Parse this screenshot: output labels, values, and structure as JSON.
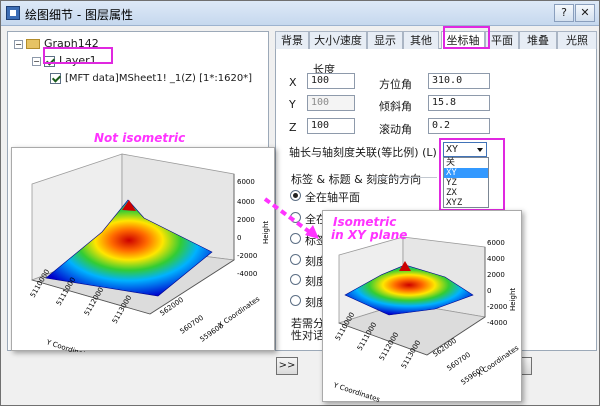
{
  "window": {
    "title": "绘图细节 - 图层属性",
    "help_label": "?",
    "close_label": "✕"
  },
  "tree": {
    "graph": "Graph142",
    "layer": "Layer1",
    "data": "[MFT data]MSheet1! _1(Z) [1*:1620*]"
  },
  "tabs": [
    "背景",
    "大小/速度",
    "显示",
    "其他",
    "坐标轴",
    "平面",
    "堆叠",
    "光照"
  ],
  "axis_form": {
    "length_header": "长度",
    "rows": [
      {
        "axis": "X",
        "length": "100",
        "angle_label": "方位角",
        "angle_value": "310.0"
      },
      {
        "axis": "Y",
        "length": "100",
        "angle_label": "倾斜角",
        "angle_value": "15.8"
      },
      {
        "axis": "Z",
        "length": "100",
        "angle_label": "滚动角",
        "angle_value": "0.2"
      }
    ],
    "link_label": "轴长与轴刻度关联(等比例) (L)",
    "dropdown": {
      "selected": "XY",
      "options": [
        "关",
        "XY",
        "YZ",
        "ZX",
        "XYZ"
      ],
      "highlighted_option": "XY"
    },
    "direction_header": "标签 & 标题 & 刻度的方向",
    "radio_options": [
      "全在轴平面",
      "全在",
      "标签",
      "刻度",
      "刻度",
      "刻度"
    ],
    "note_line1": "若需分",
    "note_line2": "性对话"
  },
  "buttons": {
    "expand_label": ">>"
  },
  "annotations": {
    "not_isometric": "Not isometric",
    "isometric_line1": "Isometric",
    "isometric_line2": "in XY plane"
  },
  "plot_left": {
    "z_ticks": [
      "6000",
      "4000",
      "2000",
      "0",
      "-2000",
      "-4000"
    ],
    "z_label": "Height",
    "x_ticks": [
      "562000",
      "560700",
      "559600"
    ],
    "x_label": "X Coordinates",
    "y_ticks": [
      "5110000",
      "5111000",
      "5112000",
      "5113000"
    ],
    "y_label": "Y Coordinates"
  },
  "plot_right": {
    "z_ticks": [
      "6000",
      "4000",
      "2000",
      "0",
      "-2000",
      "-4000"
    ],
    "z_label": "Height",
    "x_ticks": [
      "562000",
      "560700",
      "559600"
    ],
    "x_label": "X Coordinates",
    "y_ticks": [
      "5110000",
      "5111000",
      "5112000",
      "5113000"
    ],
    "y_label": "Y Coordinates"
  },
  "colors": {
    "annotation": "#ff33ff",
    "highlight_box": "#e028e0",
    "surface_low": "#0000cc",
    "surface_high": "#cc0000"
  }
}
